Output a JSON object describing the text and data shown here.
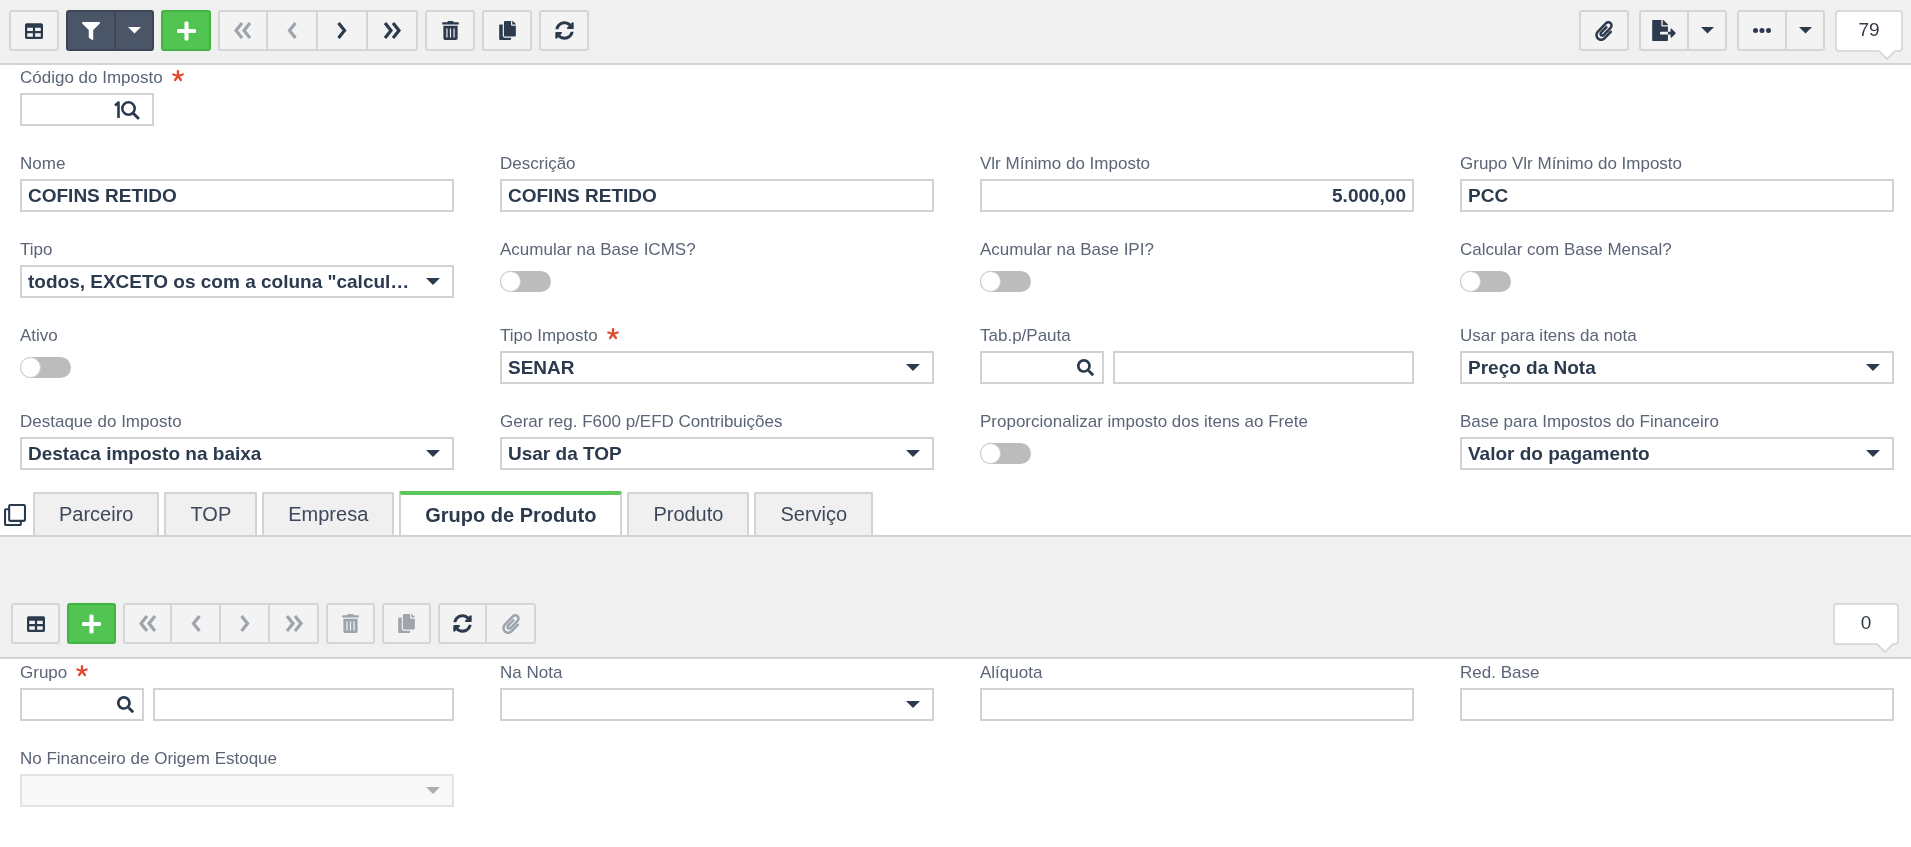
{
  "toolbar": {
    "left": [
      {
        "active": false,
        "buttons": [
          {
            "kind": "table",
            "disabled": false
          }
        ]
      },
      {
        "active": true,
        "buttons": [
          {
            "kind": "filter",
            "disabled": false
          },
          {
            "kind": "menu",
            "disabled": false
          }
        ]
      },
      {
        "active": false,
        "buttons": [
          {
            "kind": "add",
            "disabled": false
          }
        ]
      },
      {
        "active": false,
        "buttons": [
          {
            "kind": "first",
            "disabled": true
          },
          {
            "kind": "previous",
            "disabled": true
          },
          {
            "kind": "next",
            "disabled": false
          },
          {
            "kind": "last",
            "disabled": false
          }
        ]
      },
      {
        "active": false,
        "buttons": [
          {
            "kind": "delete",
            "disabled": false
          }
        ]
      },
      {
        "active": false,
        "buttons": [
          {
            "kind": "duplicate",
            "disabled": false
          }
        ]
      },
      {
        "active": false,
        "buttons": [
          {
            "kind": "refresh",
            "disabled": false
          }
        ]
      }
    ],
    "right": [
      {
        "active": false,
        "buttons": [
          {
            "kind": "attach",
            "disabled": false
          }
        ]
      },
      {
        "active": false,
        "buttons": [
          {
            "kind": "export",
            "disabled": false
          },
          {
            "kind": "menu",
            "disabled": false
          }
        ]
      },
      {
        "active": false,
        "buttons": [
          {
            "kind": "more",
            "disabled": false
          },
          {
            "kind": "menu",
            "disabled": false
          }
        ]
      }
    ],
    "record_count": "79"
  },
  "form": {
    "rows": [
      [
        {
          "kind": "code_lookup",
          "label": "Código do Imposto",
          "required": true,
          "disabled": false
        }
      ],
      [
        {
          "kind": "text",
          "label": "Nome",
          "required": false,
          "disabled": false,
          "value": "COFINS RETIDO"
        },
        {
          "kind": "text",
          "label": "Descrição",
          "required": false,
          "disabled": false,
          "value": "COFINS RETIDO"
        },
        {
          "kind": "number",
          "label": "Vlr Mínimo do Imposto",
          "required": false,
          "disabled": false,
          "value": "5.000,00"
        },
        {
          "kind": "text",
          "label": "Grupo Vlr Mínimo do Imposto",
          "required": false,
          "disabled": false,
          "value": "PCC"
        }
      ],
      [
        {
          "kind": "select",
          "label": "Tipo",
          "required": false,
          "disabled": false,
          "value": "todos, EXCETO os com a coluna \"calcul…"
        },
        {
          "kind": "toggle",
          "label": "Acumular na Base ICMS?",
          "required": false,
          "disabled": false,
          "on": false
        },
        {
          "kind": "toggle",
          "label": "Acumular na Base IPI?",
          "required": false,
          "disabled": false,
          "on": false
        },
        {
          "kind": "toggle",
          "label": "Calcular com Base Mensal?",
          "required": false,
          "disabled": false,
          "on": false
        }
      ],
      [
        {
          "kind": "toggle",
          "label": "Ativo",
          "required": false,
          "disabled": false,
          "on": false
        },
        {
          "kind": "select",
          "label": "Tipo Imposto",
          "required": true,
          "disabled": false,
          "value": "SENAR"
        },
        {
          "kind": "lookup",
          "label": "Tab.p/Pauta",
          "required": false,
          "disabled": false
        },
        {
          "kind": "select",
          "label": "Usar para itens da nota",
          "required": false,
          "disabled": false,
          "value": "Preço da Nota"
        }
      ],
      [
        {
          "kind": "select",
          "label": "Destaque do Imposto",
          "required": false,
          "disabled": false,
          "value": "Destaca imposto na baixa"
        },
        {
          "kind": "select",
          "label": "Gerar reg. F600 p/EFD Contribuições",
          "required": false,
          "disabled": false,
          "value": "Usar da TOP"
        },
        {
          "kind": "toggle",
          "label": "Proporcionalizar imposto dos itens ao Frete",
          "required": false,
          "disabled": false,
          "on": false
        },
        {
          "kind": "select",
          "label": "Base para Impostos do Financeiro",
          "required": false,
          "disabled": false,
          "value": "Valor do pagamento"
        }
      ]
    ]
  },
  "tabs": [
    {
      "label": "Parceiro",
      "selected": false
    },
    {
      "label": "TOP",
      "selected": false
    },
    {
      "label": "Empresa",
      "selected": false
    },
    {
      "label": "Grupo de Produto",
      "selected": true
    },
    {
      "label": "Produto",
      "selected": false
    },
    {
      "label": "Serviço",
      "selected": false
    }
  ],
  "detail": {
    "toolbar": {
      "left": [
        {
          "active": false,
          "buttons": [
            {
              "kind": "table",
              "disabled": false
            }
          ]
        },
        {
          "active": false,
          "buttons": [
            {
              "kind": "add",
              "disabled": false
            }
          ]
        },
        {
          "active": false,
          "buttons": [
            {
              "kind": "first",
              "disabled": true
            },
            {
              "kind": "previous",
              "disabled": true
            },
            {
              "kind": "next",
              "disabled": true
            },
            {
              "kind": "last",
              "disabled": true
            }
          ]
        },
        {
          "active": false,
          "buttons": [
            {
              "kind": "delete",
              "disabled": true
            }
          ]
        },
        {
          "active": false,
          "buttons": [
            {
              "kind": "duplicate",
              "disabled": true
            }
          ]
        },
        {
          "active": false,
          "buttons": [
            {
              "kind": "refresh",
              "disabled": false
            },
            {
              "kind": "attach",
              "disabled": true
            }
          ]
        }
      ],
      "record_count": "0"
    },
    "rows": [
      [
        {
          "kind": "lookup",
          "label": "Grupo",
          "required": true,
          "disabled": false
        },
        {
          "kind": "select",
          "label": "Na Nota",
          "required": false,
          "disabled": false
        },
        {
          "kind": "text",
          "label": "Alíquota",
          "required": false,
          "disabled": false
        },
        {
          "kind": "text",
          "label": "Red. Base",
          "required": false,
          "disabled": false
        }
      ],
      [
        {
          "kind": "select",
          "label": "No Financeiro de Origem Estoque",
          "required": false,
          "disabled": true
        }
      ]
    ]
  }
}
